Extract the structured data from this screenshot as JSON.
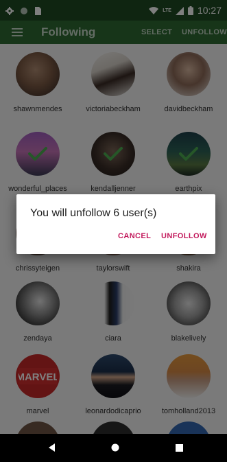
{
  "status_bar": {
    "time": "10:27",
    "network_label": "LTE",
    "icons": [
      "gear-icon",
      "circle-icon",
      "sim-icon",
      "wifi-icon",
      "signal-icon",
      "battery-icon"
    ]
  },
  "app_bar": {
    "title": "Following",
    "select_label": "SELECT",
    "unfollow_label": "UNFOLLOW"
  },
  "users": [
    {
      "name": "shawnmendes",
      "selected": false
    },
    {
      "name": "victoriabeckham",
      "selected": false
    },
    {
      "name": "davidbeckham",
      "selected": false
    },
    {
      "name": "wonderful_places",
      "selected": true
    },
    {
      "name": "kendalljenner",
      "selected": true
    },
    {
      "name": "earthpix",
      "selected": true
    },
    {
      "name": "chrissyteigen",
      "selected": false
    },
    {
      "name": "taylorswift",
      "selected": false
    },
    {
      "name": "shakira",
      "selected": false
    },
    {
      "name": "zendaya",
      "selected": false
    },
    {
      "name": "ciara",
      "selected": false
    },
    {
      "name": "blakelively",
      "selected": false
    },
    {
      "name": "marvel",
      "selected": false
    },
    {
      "name": "leonardodicaprio",
      "selected": false
    },
    {
      "name": "tomholland2013",
      "selected": false
    }
  ],
  "logo_text": {
    "marvel": "MARVEL"
  },
  "dialog": {
    "message": "You will unfollow 6 user(s)",
    "cancel_label": "CANCEL",
    "unfollow_label": "UNFOLLOW"
  },
  "colors": {
    "app_bar": "#2e6b32",
    "status_bar": "#1f4a22",
    "dialog_action": "#c2185b",
    "check": "#4caf50"
  },
  "nav_bar": {
    "icons": [
      "back-icon",
      "home-icon",
      "recents-icon"
    ]
  }
}
